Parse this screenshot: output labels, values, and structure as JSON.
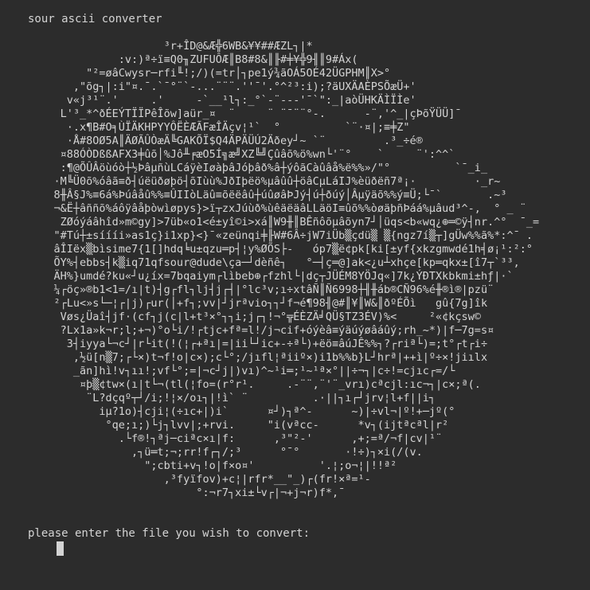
{
  "title": "sour ascii converter",
  "art_lines": [
    "                     ³r+ÎD@&Æ╬6WB&¥¥##ÆZL┐|*",
    "              :v:)ª÷ï≡Q0╖ZUFUÔÆ║B8#8&║╟#╪¥╬9╢║9#Áx(",
    "         \"²=øâCwysr─rfi╙!;/)(=tr│┐pe1ý¾ãOÁ5OÉ42ÜGPHM║X>°",
    "       ,\"õg┐|:i\"¤.¯.`¯°¨`-...¨¨¨.''¯'.°^²³:i);?äUXÄAÈPSÕæÜ+'",
    "      v«j³¹¨.'     .'     -`__¹l┐:_°`-¨---'¯`\":_|aòÜHKÄÌÏÌe'",
    "     L'³_*^ðÉEÝTÏÏPêÎõw]aür_¤  ¨     ¨ ¨¯¨¨°-.      -¨,'^_|çÞõŸÜÜ]¯",
    "      ·.x¶B#O╕ÙÏÄKHPYYÔËÈÆÃFæÎÄçv¦¹`  °          `¨·¤|;≡╪Z\"",
    "      ·Å#8OØ5A║ÄØÃÛÒæÄ╚GAKÕÏ$Q4ÄPÄÜÚ2Äðey┘~ `¨         .³_÷é®",
    "     ¤88ÓÒDßßAFX3╪ûõ│%Jô╨╒æO5Í╗æ╝XZ╚╝Çûâõ%ö%wn└'¨°    `     ¨':^^`",
    "     :¶@ÕÛÂöùóò┼½ÞâµñùLCáÿèIøàþâJóþâð%â┼ýôãCàûâå%ë%%»/\"°          `¯_i_",
    "    ·M╚Ü0õ%óâã≡ð┤úëüðøþö┤õIùù%JðIþëö%µâûû┼öâCµLáIJ%èüðëñ7ª¡·         ·_r~",
    "    8╫Â§J%≡6á%Þúâåû%%≡ÛIIòLäû≡õëëâû┼úûøâÞJý┤ú┼ðúý│Âµÿäõ%%ý≡Ü;└¯`       .~³",
    "    ¬&Ë┼âññõ%áôÿâåþòwìøpys}>ï┬zxJúùð%ùêäëäâLLäöI≡ûõ%%òøäþñÞáá%µâud³^-,  ° _ ¨",
    "     ZØóýáâhîd»m©gy]>7üb«o1<é±yî©i>xá║W9╫║BÊñôõµâõyn7┘│üqs<b«wq¿⊕═©ÿ┤nr.^°  ¯_=",
    "    \"#Tú┼±síííi»as1ç}i1xp}<}¯«zeünqi╪╟W#6Â÷jW7iÜb▒çdü▒ ▒{ngz7í▒┬]gÜw%%ã%*:^¯ .",
    "    âÎIëx▒bìsime7{1[]hdq╘u±qzu═p┤¦y%ØÕS├-   óp7▒ë¢pk[ki[±yf{xkzgmwdé1h╡ø¡¹:²:°",
    "    ÕY%┤ebbs┤k▒iq71qfsour@dude\\ça─┘dèñê┐   °─┤ç═@]ak<¿u┴xhçe[kp═qkx±[î7┬`³³,",
    "    ÄH%}umdé?ku«┘u¿íx=7bqaiym┌lìbeb⊕┌fzhl└|dç┬JÜÉM8YÖJq«]7k¿ÝÐTXkbkmi±hƒ|·`",
    "    ¼┌öç»®b1<1=/ı|t)┤g┌fl┐lj┤j┌┤|°lc³v;ı÷xtâÑ║Ñ6998┼╢╫áb®CÑ96%é╫®ì®|pzü¨",
    "    ²┌Lu<»s└─¦┌|j)┌ur(│+f┐;vv|┘jrªvio┐┐┘f¬é¶98╢@#║¥║W&║ðºÉÕì   gû{7g]îk",
    "     Vøs¿Üaî┤jf·(cf┐j(c|l+t³×°┐┐i;j┌┐!¬°╦ÉÈZÄ╛QÜ§TZ3ÉV)%<     ²«¢kçsw©",
    "     ?Lx1a»k¬r;l;+¬)°o└i/!┌tjc+fª=l!/j¬cif+óýèâ≡ýäúýøâáûý;rh_~*)|f─7g=s¤",
    "      3┤iyya└¬c┘|r└it(!(¦┌+ªı|=|ii└┘ic+-÷ª└)+ëö≡âúJÊ%%┐?┌riª└)=;t°┌t┌i÷",
    "       ,½ü[n▒7;┌└×)t¬f!o|c×);c└°;/jıfl¦ªiiº×)i1b%%b}L┘hrª|++ì|º÷×!jiılx",
    "       _ãn]hì!v┐ıı!;vf└°;=|¬c┘j|)vı)^~¹i═;¹~¹ª×°||÷¬┐|c÷!=cjıc┌=/└",
    "        ¤þ▒¢tw×(ı|t└¬(tl(¦fo=(r°r¹.     .-¨¨,¨'¨_vrı)cªcjl:ıc¬┐|c×;ª(.",
    "         ¨L?dçqº┬┘/i;!¦×/oı┐|!ì` ¨          .·||┐ı┌┘jrv¦l+f||i┐",
    "           iµ?1o)┤cji¦(÷ıc+|)i`      ¤┘)┐ª^-      ~)|÷vl¬|º!+─jº(°",
    "            °qe;ı;)└j┐lvv|;+rvi.     \"i(vªcc-      *v┐(ijtªcªl|r²",
    "              .└f®!┐ªj─ciªc×ı|f:      ,³\"²-'      ,+;=ª/¬f|cv|¹¨",
    "                ,┐ü═t;¬;rr!f┌┐/;³      °¯°       ·!÷)┐×i(/(v.",
    "                  \";cbti+v┐!o|f×o¤'          '.¦;o¬¦|!!ª²",
    "                     ,³fyïfov)+c¦|rfr*__\"_)┌(fr!×ª=¹-",
    "                          °:¬r7┐xi±└v┌|¬+j¬r)f*,¯"
  ],
  "prompt": "please enter the file you wish to convert:"
}
